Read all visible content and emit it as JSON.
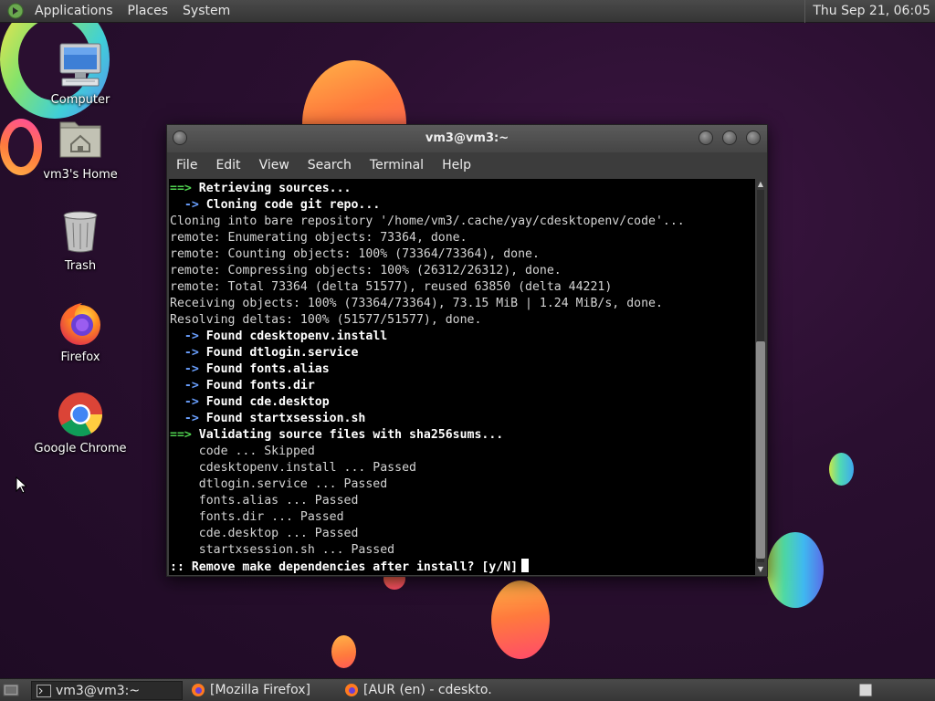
{
  "top_panel": {
    "menus": [
      "Applications",
      "Places",
      "System"
    ],
    "clock": "Thu Sep 21, 06:05"
  },
  "desktop": {
    "icons": [
      {
        "label": "Computer",
        "icon": "computer-icon"
      },
      {
        "label": "vm3's Home",
        "icon": "home-folder-icon"
      },
      {
        "label": "Trash",
        "icon": "trash-icon"
      },
      {
        "label": "Firefox",
        "icon": "firefox-icon"
      },
      {
        "label": "Google Chrome",
        "icon": "chrome-icon"
      }
    ]
  },
  "terminal": {
    "title": "vm3@vm3:~",
    "menus": [
      "File",
      "Edit",
      "View",
      "Search",
      "Terminal",
      "Help"
    ],
    "lines": [
      {
        "prefix": "==> ",
        "prefix_style": "green",
        "text": "Retrieving sources...",
        "bold": true
      },
      {
        "prefix": "  -> ",
        "prefix_style": "blue",
        "text": "Cloning code git repo...",
        "bold": true
      },
      {
        "prefix": "",
        "prefix_style": "",
        "text": "Cloning into bare repository '/home/vm3/.cache/yay/cdesktopenv/code'...",
        "bold": false
      },
      {
        "prefix": "",
        "prefix_style": "",
        "text": "remote: Enumerating objects: 73364, done.",
        "bold": false
      },
      {
        "prefix": "",
        "prefix_style": "",
        "text": "remote: Counting objects: 100% (73364/73364), done.",
        "bold": false
      },
      {
        "prefix": "",
        "prefix_style": "",
        "text": "remote: Compressing objects: 100% (26312/26312), done.",
        "bold": false
      },
      {
        "prefix": "",
        "prefix_style": "",
        "text": "remote: Total 73364 (delta 51577), reused 63850 (delta 44221)",
        "bold": false
      },
      {
        "prefix": "",
        "prefix_style": "",
        "text": "Receiving objects: 100% (73364/73364), 73.15 MiB | 1.24 MiB/s, done.",
        "bold": false
      },
      {
        "prefix": "",
        "prefix_style": "",
        "text": "Resolving deltas: 100% (51577/51577), done.",
        "bold": false
      },
      {
        "prefix": "  -> ",
        "prefix_style": "blue",
        "text": "Found cdesktopenv.install",
        "bold": true
      },
      {
        "prefix": "  -> ",
        "prefix_style": "blue",
        "text": "Found dtlogin.service",
        "bold": true
      },
      {
        "prefix": "  -> ",
        "prefix_style": "blue",
        "text": "Found fonts.alias",
        "bold": true
      },
      {
        "prefix": "  -> ",
        "prefix_style": "blue",
        "text": "Found fonts.dir",
        "bold": true
      },
      {
        "prefix": "  -> ",
        "prefix_style": "blue",
        "text": "Found cde.desktop",
        "bold": true
      },
      {
        "prefix": "  -> ",
        "prefix_style": "blue",
        "text": "Found startxsession.sh",
        "bold": true
      },
      {
        "prefix": "==> ",
        "prefix_style": "green",
        "text": "Validating source files with sha256sums...",
        "bold": true
      },
      {
        "prefix": "",
        "prefix_style": "",
        "text": "    code ... Skipped",
        "bold": false
      },
      {
        "prefix": "",
        "prefix_style": "",
        "text": "    cdesktopenv.install ... Passed",
        "bold": false
      },
      {
        "prefix": "",
        "prefix_style": "",
        "text": "    dtlogin.service ... Passed",
        "bold": false
      },
      {
        "prefix": "",
        "prefix_style": "",
        "text": "    fonts.alias ... Passed",
        "bold": false
      },
      {
        "prefix": "",
        "prefix_style": "",
        "text": "    fonts.dir ... Passed",
        "bold": false
      },
      {
        "prefix": "",
        "prefix_style": "",
        "text": "    cde.desktop ... Passed",
        "bold": false
      },
      {
        "prefix": "",
        "prefix_style": "",
        "text": "    startxsession.sh ... Passed",
        "bold": false
      },
      {
        "prefix": "",
        "prefix_style": "",
        "text": ":: Remove make dependencies after install? [y/N]",
        "bold": true,
        "cursor": true
      }
    ]
  },
  "taskbar": {
    "tasks": [
      {
        "label": "vm3@vm3:~",
        "icon": "terminal-icon",
        "active": true
      },
      {
        "label": "[Mozilla Firefox]",
        "icon": "firefox-icon",
        "active": false
      },
      {
        "label": "[AUR (en) - cdeskto...",
        "icon": "firefox-icon",
        "active": false
      }
    ]
  },
  "colors": {
    "arrow_green": "#4fd14f",
    "arrow_blue": "#6aa0ff",
    "terminal_bg": "#000000",
    "panel_bg": "#3e3e3e"
  }
}
